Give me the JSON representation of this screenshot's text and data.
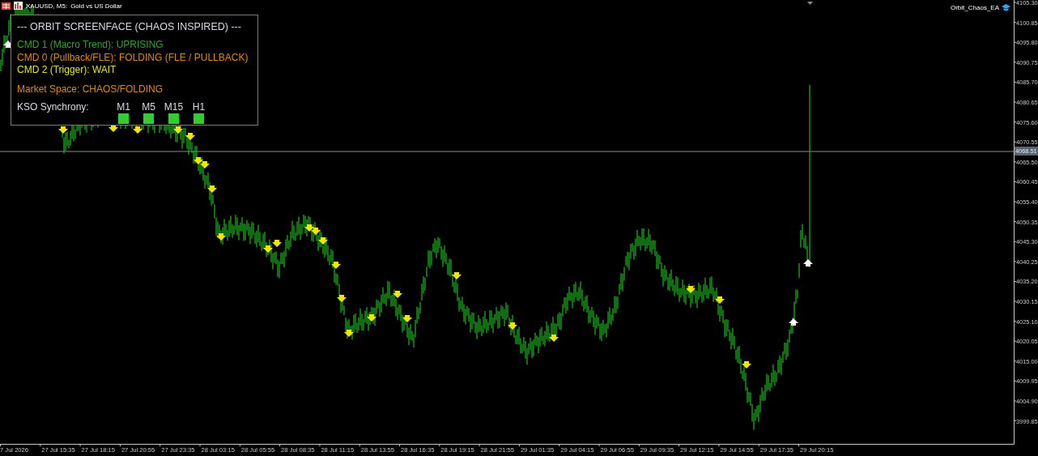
{
  "chart_header": {
    "symbol": "XAUUSD, M5:",
    "description": "Gold vs US Dollar"
  },
  "expert": {
    "name": "Orbit_Chaos_EA"
  },
  "panel": {
    "title": "--- ORBIT SCREENFACE (CHAOS INSPIRED) ---",
    "lines": [
      {
        "text": "CMD 1 (Macro Trend): UPRISING",
        "color": "#2aa82a"
      },
      {
        "text": "CMD 0 (Pullback/FLE): FOLDING (FLE / PULLBACK)",
        "color": "#e08a00"
      },
      {
        "text": "CMD 2 (Trigger): WAIT",
        "color": "#e6e600"
      }
    ],
    "market_space": {
      "text": "Market Space: CHAOS/FOLDING",
      "color": "#e08a00"
    },
    "sync": {
      "label": "KSO Synchrony:",
      "timeframes": [
        {
          "label": "M1",
          "color": "#33cc33"
        },
        {
          "label": "M5",
          "color": "#33cc33"
        },
        {
          "label": "M15",
          "color": "#33cc33"
        },
        {
          "label": "H1",
          "color": "#33cc33"
        }
      ]
    }
  },
  "price_axis": {
    "labels": [
      "4105.30",
      "4100.85",
      "4095.80",
      "4090.75",
      "4085.70",
      "4080.65",
      "4075.60",
      "4070.55",
      "4065.50",
      "4060.45",
      "4055.40",
      "4050.35",
      "4045.30",
      "4040.25",
      "4035.20",
      "4030.15",
      "4025.10",
      "4020.05",
      "4015.00",
      "4009.95",
      "4004.90",
      "3999.85"
    ],
    "current_price": "4068.51"
  },
  "time_axis": {
    "labels": [
      "7 Jul 2026",
      "27 Jul 15:35",
      "27 Jul 18:15",
      "27 Jul 20:55",
      "27 Jul 23:35",
      "28 Jul 03:15",
      "28 Jul 05:55",
      "28 Jul 08:35",
      "28 Jul 11:15",
      "28 Jul 13:55",
      "28 Jul 16:35",
      "28 Jul 19:15",
      "28 Jul 21:55",
      "29 Jul 01:35",
      "29 Jul 04:15",
      "29 Jul 06:55",
      "29 Jul 09:35",
      "29 Jul 12:15",
      "29 Jul 14:55",
      "29 Jul 17:35",
      "29 Jul 20:15"
    ]
  }
}
